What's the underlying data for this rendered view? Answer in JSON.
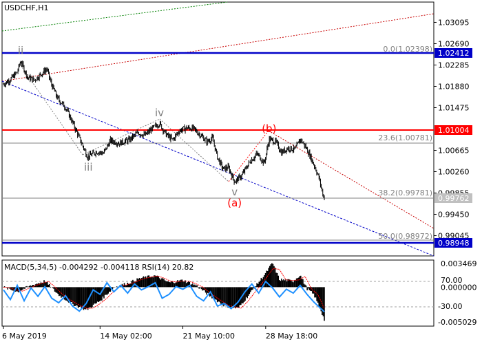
{
  "chart_data": [
    {
      "type": "candlestick",
      "symbol": "USDCHF,H1",
      "x_ticks": [
        "6 May 2019",
        "14 May 02:00",
        "21 May 10:00",
        "28 May 18:00"
      ],
      "y_ticks": [
        1.03095,
        1.0269,
        1.02285,
        1.0188,
        1.01475,
        1.01004,
        1.00665,
        1.0026,
        0.99855,
        0.9945,
        0.99045
      ],
      "ylim": [
        0.9866,
        1.0348
      ],
      "close_path": [
        {
          "t": 0,
          "y": 1.0192
        },
        {
          "t": 1,
          "y": 1.0201
        },
        {
          "t": 2,
          "y": 1.0215
        },
        {
          "t": 2.5,
          "y": 1.0236
        },
        {
          "t": 3.5,
          "y": 1.0205
        },
        {
          "t": 4.5,
          "y": 1.02
        },
        {
          "t": 5.5,
          "y": 1.0212
        },
        {
          "t": 6.3,
          "y": 1.0221
        },
        {
          "t": 6.9,
          "y": 1.0194
        },
        {
          "t": 7.8,
          "y": 1.0166
        },
        {
          "t": 9,
          "y": 1.0148
        },
        {
          "t": 10,
          "y": 1.012
        },
        {
          "t": 11,
          "y": 1.009
        },
        {
          "t": 12.2,
          "y": 1.0054
        },
        {
          "t": 13.5,
          "y": 1.0064
        },
        {
          "t": 14.5,
          "y": 1.0061
        },
        {
          "t": 15.5,
          "y": 1.0085
        },
        {
          "t": 16.8,
          "y": 1.008
        },
        {
          "t": 18.2,
          "y": 1.0086
        },
        {
          "t": 19.5,
          "y": 1.01
        },
        {
          "t": 20.5,
          "y": 1.0095
        },
        {
          "t": 21.5,
          "y": 1.0107
        },
        {
          "t": 22.6,
          "y": 1.0118
        },
        {
          "t": 23.5,
          "y": 1.0098
        },
        {
          "t": 24.5,
          "y": 1.0086
        },
        {
          "t": 25.5,
          "y": 1.0104
        },
        {
          "t": 26.5,
          "y": 1.0109
        },
        {
          "t": 27.5,
          "y": 1.0108
        },
        {
          "t": 28.5,
          "y": 1.0096
        },
        {
          "t": 29.5,
          "y": 1.0083
        },
        {
          "t": 30.3,
          "y": 1.009
        },
        {
          "t": 31,
          "y": 1.0054
        },
        {
          "t": 31.8,
          "y": 1.0031
        },
        {
          "t": 32.6,
          "y": 1.0034
        },
        {
          "t": 33.5,
          "y": 1.0007
        },
        {
          "t": 34.5,
          "y": 1.0018
        },
        {
          "t": 35.7,
          "y": 1.0045
        },
        {
          "t": 36.8,
          "y": 1.006
        },
        {
          "t": 37.8,
          "y": 1.0042
        },
        {
          "t": 38.5,
          "y": 1.0088
        },
        {
          "t": 39.5,
          "y": 1.0082
        },
        {
          "t": 40.3,
          "y": 1.0062
        },
        {
          "t": 41.2,
          "y": 1.0071
        },
        {
          "t": 42.3,
          "y": 1.0068
        },
        {
          "t": 43,
          "y": 1.0088
        },
        {
          "t": 43.8,
          "y": 1.0073
        },
        {
          "t": 44.5,
          "y": 1.0054
        },
        {
          "t": 45.2,
          "y": 1.0033
        },
        {
          "t": 45.8,
          "y": 1.0011
        },
        {
          "t": 46.2,
          "y": 0.9987
        },
        {
          "t": 46.5,
          "y": 0.9976
        }
      ],
      "horizontal_levels": [
        {
          "value": 1.02412,
          "label": "1.02412",
          "color": "#0000C8"
        },
        {
          "value": 1.01004,
          "label": "1.01004",
          "color": "#FF0000"
        },
        {
          "value": 0.98948,
          "label": "0.98948",
          "color": "#0000C8"
        },
        {
          "value": 0.99762,
          "label": "0.99762",
          "color": "#C0C0C0"
        }
      ],
      "fibonacci_levels": [
        {
          "value": 1.02398,
          "label": "0.0(1.02398)"
        },
        {
          "value": 1.00781,
          "label": "23.6(1.00781)"
        },
        {
          "value": 0.99781,
          "label": "38.2(0.99781)"
        },
        {
          "value": 0.98972,
          "label": "50.0(0.98972)"
        }
      ],
      "wave_labels": [
        {
          "text": "ii",
          "t": 2.5,
          "y": 1.0236,
          "color": "#808080",
          "pos": "above"
        },
        {
          "text": "iii",
          "t": 12.3,
          "y": 1.0054,
          "color": "#808080",
          "pos": "below"
        },
        {
          "text": "iv",
          "t": 22.6,
          "y": 1.0118,
          "color": "#808080",
          "pos": "above"
        },
        {
          "text": "v",
          "t": 33.5,
          "y": 1.0007,
          "color": "#808080",
          "pos": "below"
        },
        {
          "text": "(a)",
          "t": 33.5,
          "y": 1.0007,
          "color": "#FF0000",
          "pos": "below2"
        },
        {
          "text": "(b)",
          "t": 38.5,
          "y": 1.0088,
          "color": "#FF0000",
          "pos": "above"
        }
      ],
      "colors": {
        "candles": "#000000",
        "fib": "#808080",
        "trend_blue": "#0000C8",
        "trend_red": "#C80000",
        "trend_green": "#008000"
      }
    },
    {
      "type": "indicator",
      "title": "MACD(5,34,5) -0.004292 -0.004118 RSI(14) 20.82",
      "y_ticks": [
        "0.003469",
        "70.00",
        "0.000000",
        "-30.00",
        "-0.005029"
      ],
      "macd_ylim": [
        -0.005029,
        0.003469
      ],
      "rsi_levels": [
        70,
        30
      ],
      "macd_hist": [
        {
          "t": 0,
          "v": 0.0
        },
        {
          "t": 2,
          "v": -0.0006
        },
        {
          "t": 4,
          "v": 0.0002
        },
        {
          "t": 6,
          "v": 0.0008
        },
        {
          "t": 8,
          "v": -0.001
        },
        {
          "t": 10,
          "v": -0.0022
        },
        {
          "t": 12,
          "v": -0.003
        },
        {
          "t": 14,
          "v": -0.0018
        },
        {
          "t": 16,
          "v": 0.0
        },
        {
          "t": 18,
          "v": 0.0005
        },
        {
          "t": 20,
          "v": 0.0012
        },
        {
          "t": 22,
          "v": 0.0015
        },
        {
          "t": 24,
          "v": 0.0006
        },
        {
          "t": 26,
          "v": 0.0009
        },
        {
          "t": 28,
          "v": 0.0002
        },
        {
          "t": 30,
          "v": -0.0012
        },
        {
          "t": 32,
          "v": -0.0024
        },
        {
          "t": 34,
          "v": -0.0028
        },
        {
          "t": 36,
          "v": -0.0005
        },
        {
          "t": 38,
          "v": 0.0018
        },
        {
          "t": 39,
          "v": 0.0032
        },
        {
          "t": 40,
          "v": 0.001
        },
        {
          "t": 42,
          "v": 0.0008
        },
        {
          "t": 43,
          "v": 0.0016
        },
        {
          "t": 44,
          "v": -0.0002
        },
        {
          "t": 45,
          "v": -0.001
        },
        {
          "t": 46,
          "v": -0.003
        },
        {
          "t": 46.5,
          "v": -0.0043
        }
      ],
      "rsi": [
        {
          "t": 0,
          "v": 55
        },
        {
          "t": 1,
          "v": 40
        },
        {
          "t": 2,
          "v": 62
        },
        {
          "t": 3,
          "v": 38
        },
        {
          "t": 4,
          "v": 58
        },
        {
          "t": 5,
          "v": 45
        },
        {
          "t": 6,
          "v": 60
        },
        {
          "t": 7,
          "v": 42
        },
        {
          "t": 8,
          "v": 35
        },
        {
          "t": 9,
          "v": 46
        },
        {
          "t": 10,
          "v": 30
        },
        {
          "t": 11,
          "v": 22
        },
        {
          "t": 12,
          "v": 34
        },
        {
          "t": 13,
          "v": 55
        },
        {
          "t": 14,
          "v": 48
        },
        {
          "t": 15,
          "v": 66
        },
        {
          "t": 16,
          "v": 52
        },
        {
          "t": 17,
          "v": 62
        },
        {
          "t": 18,
          "v": 50
        },
        {
          "t": 19,
          "v": 64
        },
        {
          "t": 20,
          "v": 55
        },
        {
          "t": 21,
          "v": 60
        },
        {
          "t": 22,
          "v": 66
        },
        {
          "t": 23,
          "v": 42
        },
        {
          "t": 24,
          "v": 48
        },
        {
          "t": 25,
          "v": 60
        },
        {
          "t": 26,
          "v": 56
        },
        {
          "t": 27,
          "v": 62
        },
        {
          "t": 28,
          "v": 45
        },
        {
          "t": 29,
          "v": 38
        },
        {
          "t": 30,
          "v": 52
        },
        {
          "t": 31,
          "v": 30
        },
        {
          "t": 32,
          "v": 34
        },
        {
          "t": 33,
          "v": 26
        },
        {
          "t": 34,
          "v": 36
        },
        {
          "t": 35,
          "v": 52
        },
        {
          "t": 36,
          "v": 64
        },
        {
          "t": 37,
          "v": 50
        },
        {
          "t": 38,
          "v": 68
        },
        {
          "t": 39,
          "v": 58
        },
        {
          "t": 40,
          "v": 44
        },
        {
          "t": 41,
          "v": 56
        },
        {
          "t": 42,
          "v": 50
        },
        {
          "t": 43,
          "v": 62
        },
        {
          "t": 44,
          "v": 48
        },
        {
          "t": 45,
          "v": 36
        },
        {
          "t": 46,
          "v": 26
        },
        {
          "t": 46.5,
          "v": 21
        }
      ],
      "colors": {
        "hist": "#000000",
        "signal": "#FF0000",
        "rsi": "#1E90FF",
        "level": "#A0A0A0"
      }
    }
  ]
}
